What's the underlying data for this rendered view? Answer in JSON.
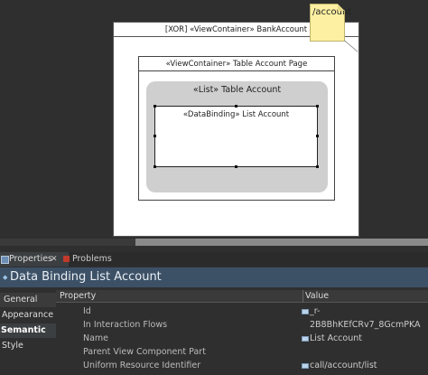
{
  "diagram": {
    "bank_container": "[XOR] «ViewContainer» BankAccount",
    "page_container": "«ViewContainer» Table Account Page",
    "list_title": "«List»  Table Account",
    "binding_title": "«DataBinding»  List Account",
    "note_text": "/account"
  },
  "tabs": {
    "properties": "Properties",
    "close": "✕",
    "problems": "Problems"
  },
  "header": {
    "title": "Data Binding List Account"
  },
  "sidebar": {
    "items": [
      "General",
      "Appearance",
      "Semantic",
      "Style"
    ]
  },
  "table": {
    "col_property": "Property",
    "col_value": "Value",
    "rows": [
      {
        "property": "Id",
        "value": "_r-2B8BhKEfCRv7_8GcmPKA"
      },
      {
        "property": "In Interaction Flows",
        "value": ""
      },
      {
        "property": "Name",
        "value": "List Account"
      },
      {
        "property": "Parent View Component Part",
        "value": ""
      },
      {
        "property": "Uniform Resource Identifier",
        "value": "call/account/list"
      }
    ]
  }
}
